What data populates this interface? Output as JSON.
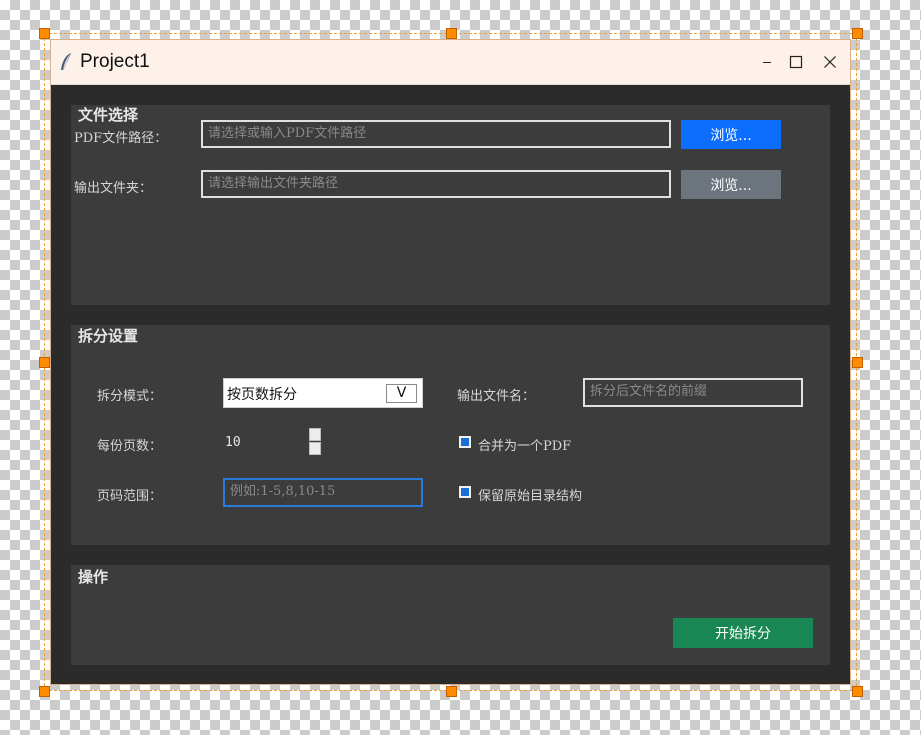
{
  "window": {
    "title": "Project1"
  },
  "file_section": {
    "title": "文件选择",
    "pdf_label": "PDF文件路径：",
    "pdf_placeholder": "请选择或输入PDF文件路径",
    "browse_pdf_label": "浏览...",
    "output_label": "输出文件夹：",
    "output_placeholder": "请选择输出文件夹路径",
    "browse_output_label": "浏览..."
  },
  "split_section": {
    "title": "拆分设置",
    "mode_label": "拆分模式：",
    "mode_value": "按页数拆分",
    "mode_arrow": "V",
    "pages_label": "每份页数：",
    "pages_value": "10",
    "range_label": "页码范围：",
    "range_placeholder": "例如:1-5,8,10-15",
    "output_name_label": "输出文件名：",
    "output_name_placeholder": "拆分后文件名的前缀",
    "merge_label": "合并为一个PDF",
    "merge_checked": true,
    "keep_toc_label": "保留原始目录结构",
    "keep_toc_checked": true
  },
  "action_section": {
    "title": "操作",
    "start_label": "开始拆分"
  },
  "colors": {
    "accent_blue": "#0d6efd",
    "secondary_gray": "#6c757d",
    "success_green": "#198754"
  }
}
